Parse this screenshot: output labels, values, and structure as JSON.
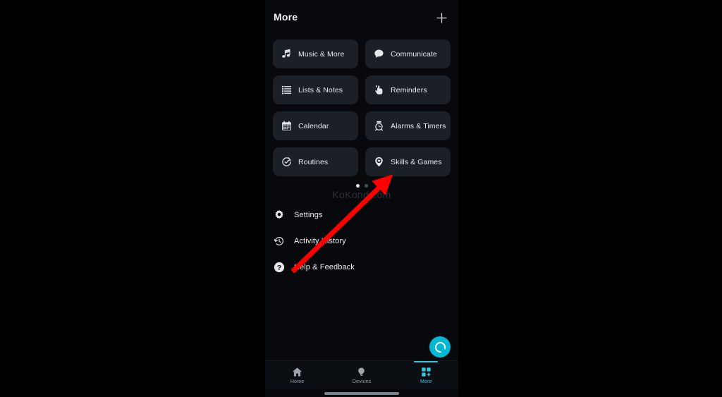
{
  "app": {
    "header": {
      "title": "More",
      "add_icon": "plus-icon"
    },
    "grid": {
      "rows": [
        [
          {
            "label": "Music & More",
            "icon": "music-note-icon"
          },
          {
            "label": "Communicate",
            "icon": "speech-bubble-icon"
          }
        ],
        [
          {
            "label": "Lists & Notes",
            "icon": "list-lines-icon"
          },
          {
            "label": "Reminders",
            "icon": "hand-string-icon"
          }
        ],
        [
          {
            "label": "Calendar",
            "icon": "calendar-icon"
          },
          {
            "label": "Alarms & Timers",
            "icon": "alarm-clock-icon"
          }
        ],
        [
          {
            "label": "Routines",
            "icon": "routine-check-icon"
          },
          {
            "label": "Skills & Games",
            "icon": "skills-pin-icon"
          }
        ]
      ]
    },
    "pager": {
      "total": 2,
      "active_index": 0
    },
    "watermark": "KoKond.com",
    "menu": [
      {
        "label": "Settings",
        "icon": "gear-icon"
      },
      {
        "label": "Activity History",
        "icon": "clock-history-icon"
      },
      {
        "label": "Help & Feedback",
        "icon": "question-circle-icon"
      }
    ],
    "fab": {
      "name": "alexa-button"
    },
    "bottom_nav": {
      "active": "More",
      "items": [
        {
          "label": "Home",
          "icon": "home-icon",
          "active": false
        },
        {
          "label": "Devices",
          "icon": "bulb-icon",
          "active": false
        },
        {
          "label": "More",
          "icon": "grid-plus-icon",
          "active": true
        }
      ]
    }
  },
  "annotation": {
    "arrow_color": "#FF0000",
    "points_to": "Skills & Games"
  },
  "colors": {
    "app_background": "#07090d",
    "tile_background": "#1b2027",
    "accent_cyan": "#37c6e0",
    "alexa_blue": "#00b7d4",
    "text_primary": "#e9ebed"
  }
}
